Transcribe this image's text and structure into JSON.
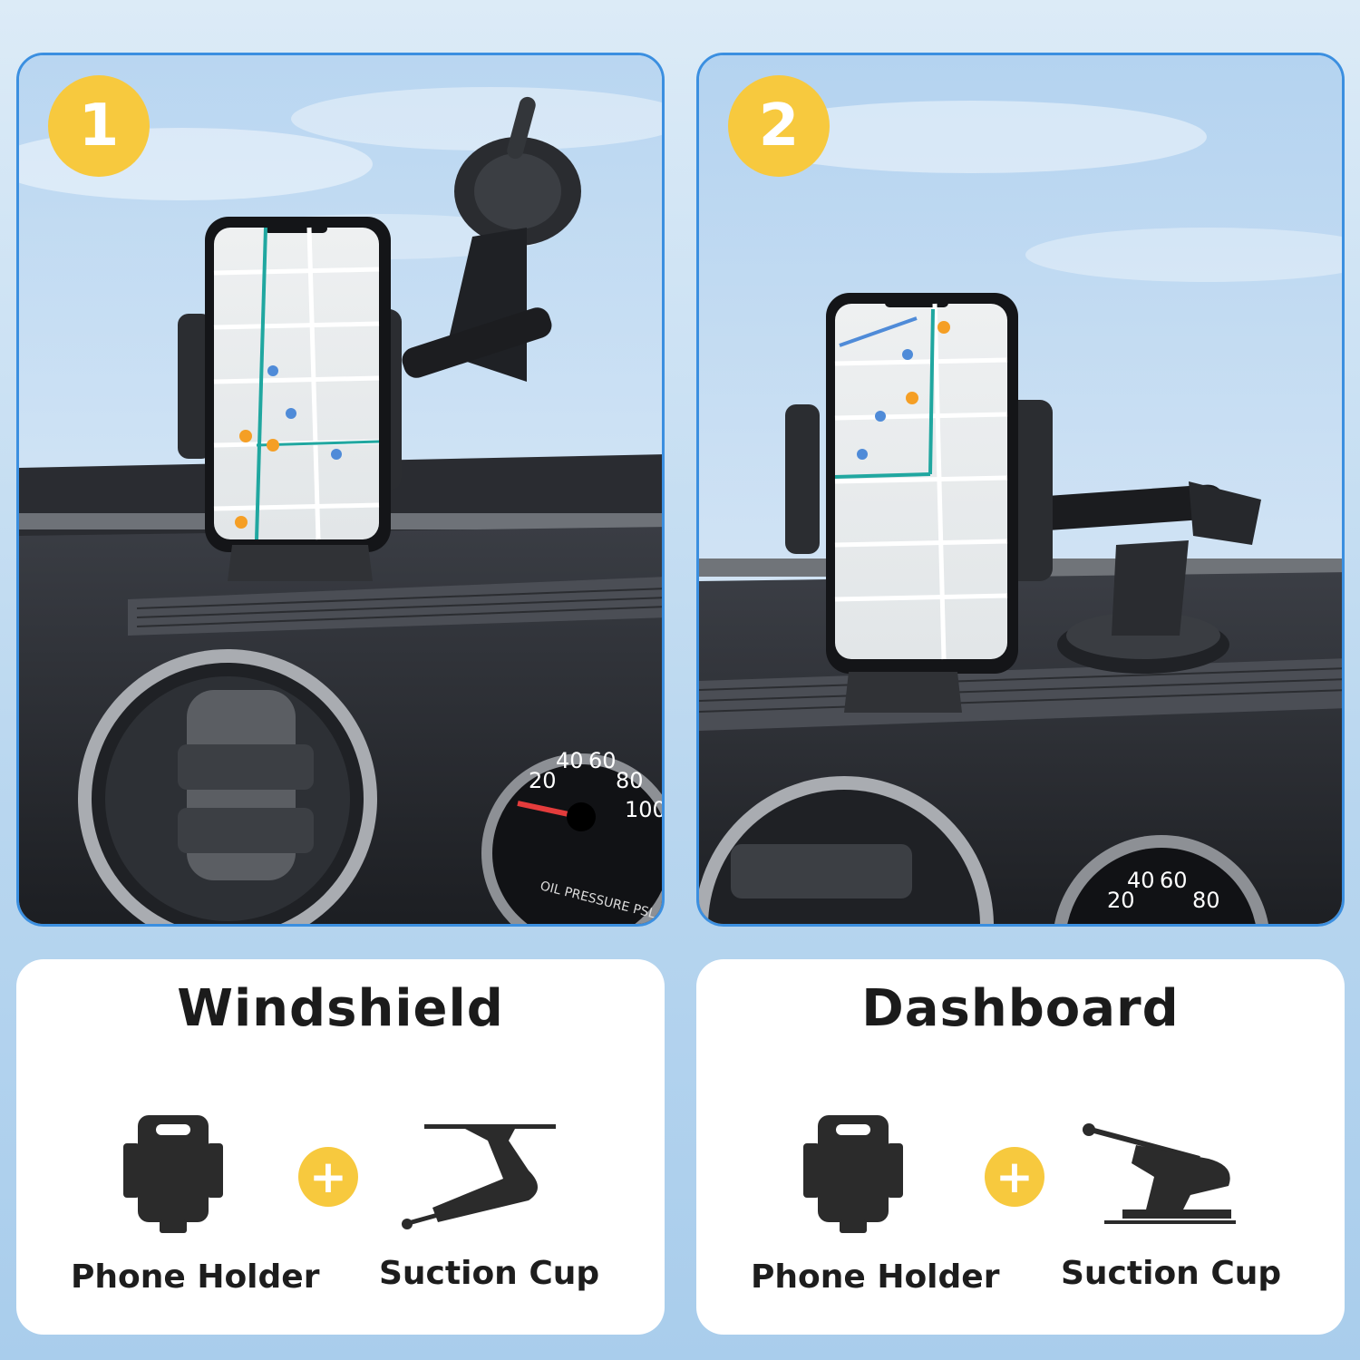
{
  "panels": [
    {
      "number": "1",
      "title": "Windshield",
      "parts": {
        "holder_label": "Phone Holder",
        "cup_label": "Suction Cup"
      },
      "plus": "+"
    },
    {
      "number": "2",
      "title": "Dashboard",
      "parts": {
        "holder_label": "Phone Holder",
        "cup_label": "Suction Cup"
      },
      "plus": "+"
    }
  ],
  "colors": {
    "accent_yellow": "#f7c93e",
    "panel_border": "#3b8fe0",
    "icon_dark": "#2b2b2b"
  },
  "icons": [
    "phone-holder-icon",
    "windshield-suction-cup-icon",
    "dashboard-suction-cup-icon",
    "plus-icon"
  ]
}
